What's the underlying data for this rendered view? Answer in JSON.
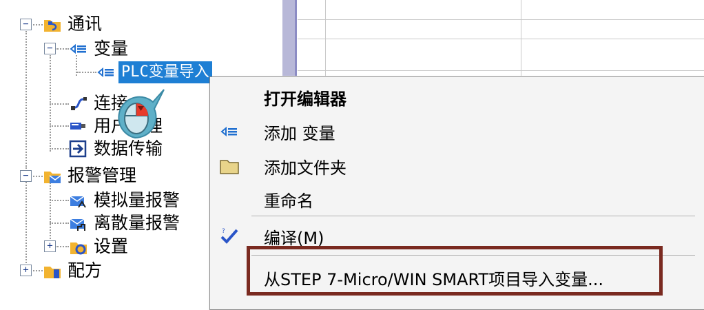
{
  "tree": {
    "items": [
      {
        "label": "通讯",
        "icon": "folder-network-icon",
        "expander": "−"
      },
      {
        "label": "变量",
        "icon": "variable-tag-icon",
        "expander": "−"
      },
      {
        "label": "PLC变量导入",
        "icon": "variable-tag-icon",
        "selected": true
      },
      {
        "label": "连接",
        "icon": "connection-icon"
      },
      {
        "label": "用户管理",
        "icon": "user-icon"
      },
      {
        "label": "数据传输",
        "icon": "data-transfer-icon"
      },
      {
        "label": "报警管理",
        "icon": "folder-alarm-icon",
        "expander": "−"
      },
      {
        "label": "模拟量报警",
        "icon": "analog-alarm-icon"
      },
      {
        "label": "离散量报警",
        "icon": "discrete-alarm-icon"
      },
      {
        "label": "设置",
        "icon": "folder-settings-icon",
        "expander": "+"
      },
      {
        "label": "配方",
        "icon": "folder-recipe-icon",
        "expander": "+"
      }
    ]
  },
  "context_menu": {
    "items": [
      {
        "label": "打开编辑器",
        "icon": "",
        "bold": true
      },
      {
        "label": "添加 变量",
        "icon": "variable-tag-icon"
      },
      {
        "label": "添加文件夹",
        "icon": "folder-icon"
      },
      {
        "label": "重命名",
        "icon": ""
      },
      {
        "label": "编译(M)",
        "icon": "compile-check-icon"
      },
      {
        "label": "从STEP 7-Micro/WIN SMART项目导入变量...",
        "icon": ""
      }
    ]
  },
  "colors": {
    "selection": "#1e7fd4",
    "highlight_box": "#7a2a20",
    "mouse_bubble": "#5fb0c8"
  }
}
